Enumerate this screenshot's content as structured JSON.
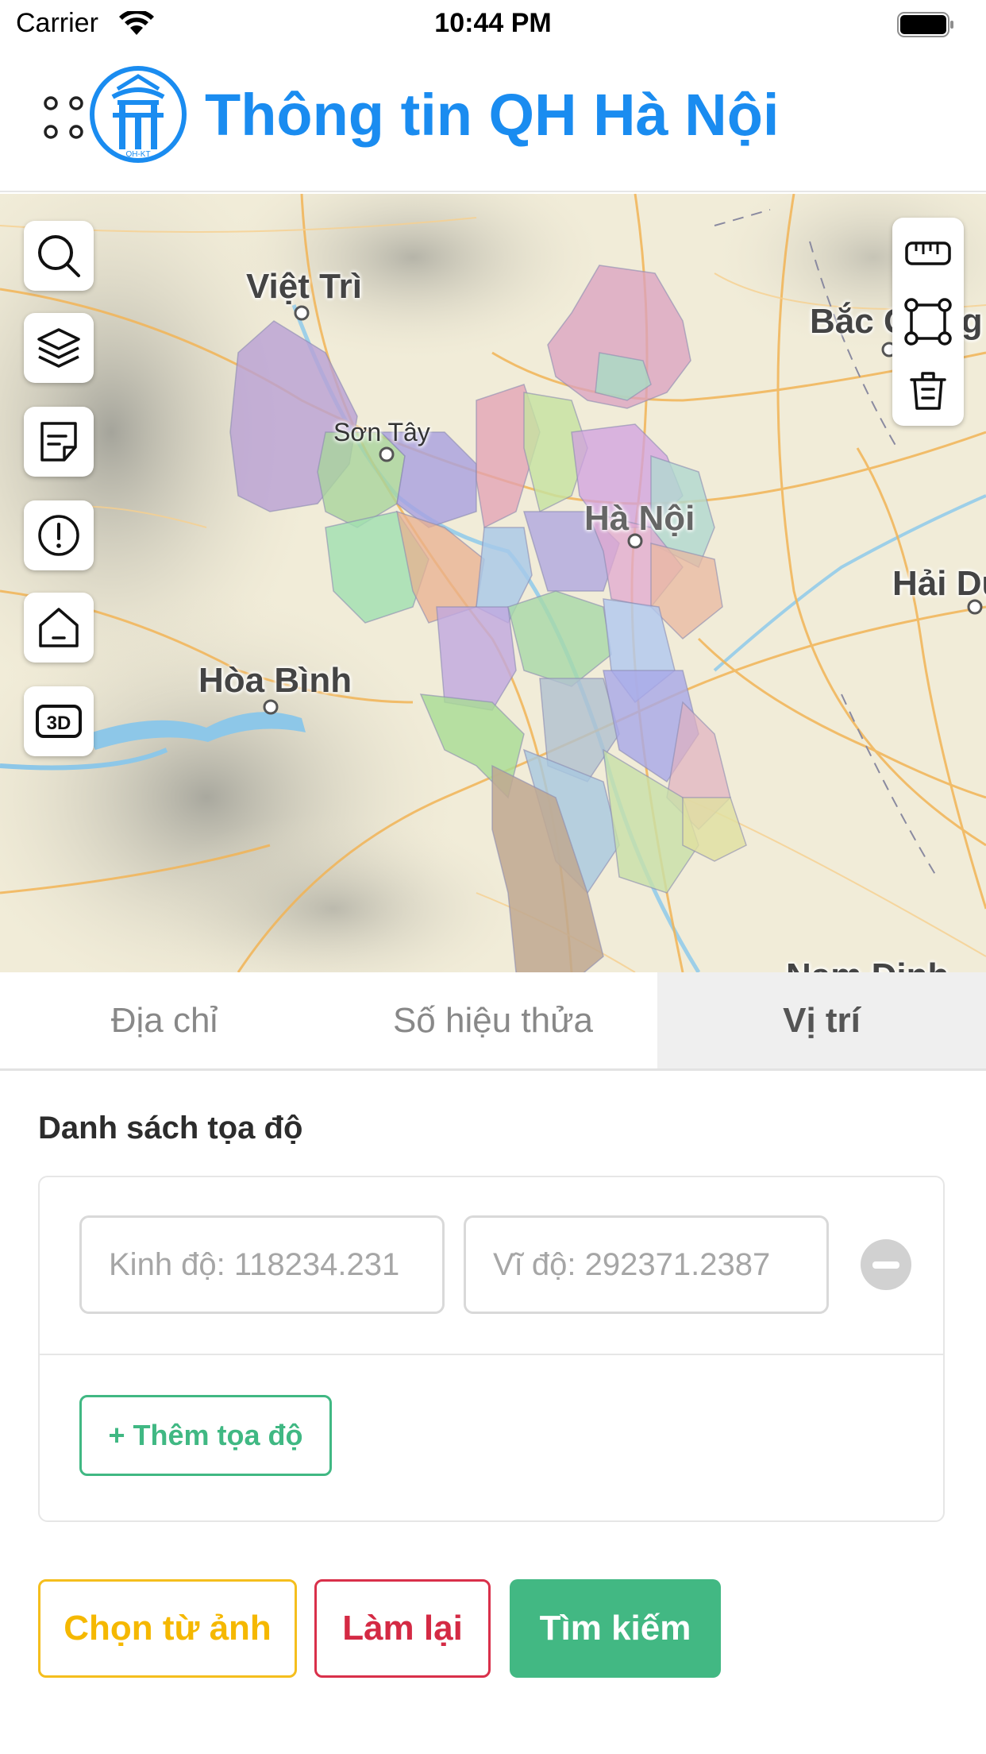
{
  "status_bar": {
    "carrier": "Carrier",
    "time": "10:44 PM"
  },
  "header": {
    "title": "Thông tin QH Hà Nội",
    "logo_text": "QH-KT"
  },
  "map": {
    "labels": {
      "viet_tri": "Việt Trì",
      "son_tay": "Sơn Tây",
      "ha_noi": "Hà Nội",
      "hoa_binh": "Hòa Bình",
      "bac_giang": "Bắc Giang",
      "hai_duong": "Hải Dương",
      "nam_dinh": "Nam Định"
    },
    "left_tools": [
      "search-icon",
      "layers-icon",
      "note-icon",
      "info-icon",
      "home-icon",
      "3d-icon"
    ],
    "three_d_label": "3D",
    "right_tools": [
      "ruler-icon",
      "polygon-icon",
      "trash-icon"
    ]
  },
  "tabs": [
    {
      "label": "Địa chỉ",
      "active": false
    },
    {
      "label": "Số hiệu thửa",
      "active": false
    },
    {
      "label": "Vị trí",
      "active": true
    }
  ],
  "form": {
    "section_title": "Danh sách tọa độ",
    "longitude_placeholder": "Kinh độ: 118234.231",
    "latitude_placeholder": "Vĩ độ: 292371.2387",
    "add_label": "+ Thêm tọa độ"
  },
  "actions": {
    "choose_image": "Chọn từ ảnh",
    "reset": "Làm lại",
    "search": "Tìm kiếm"
  },
  "colors": {
    "brand_blue": "#1a8cf0",
    "green": "#42b883",
    "yellow": "#f5be1d",
    "red": "#d9304a"
  }
}
